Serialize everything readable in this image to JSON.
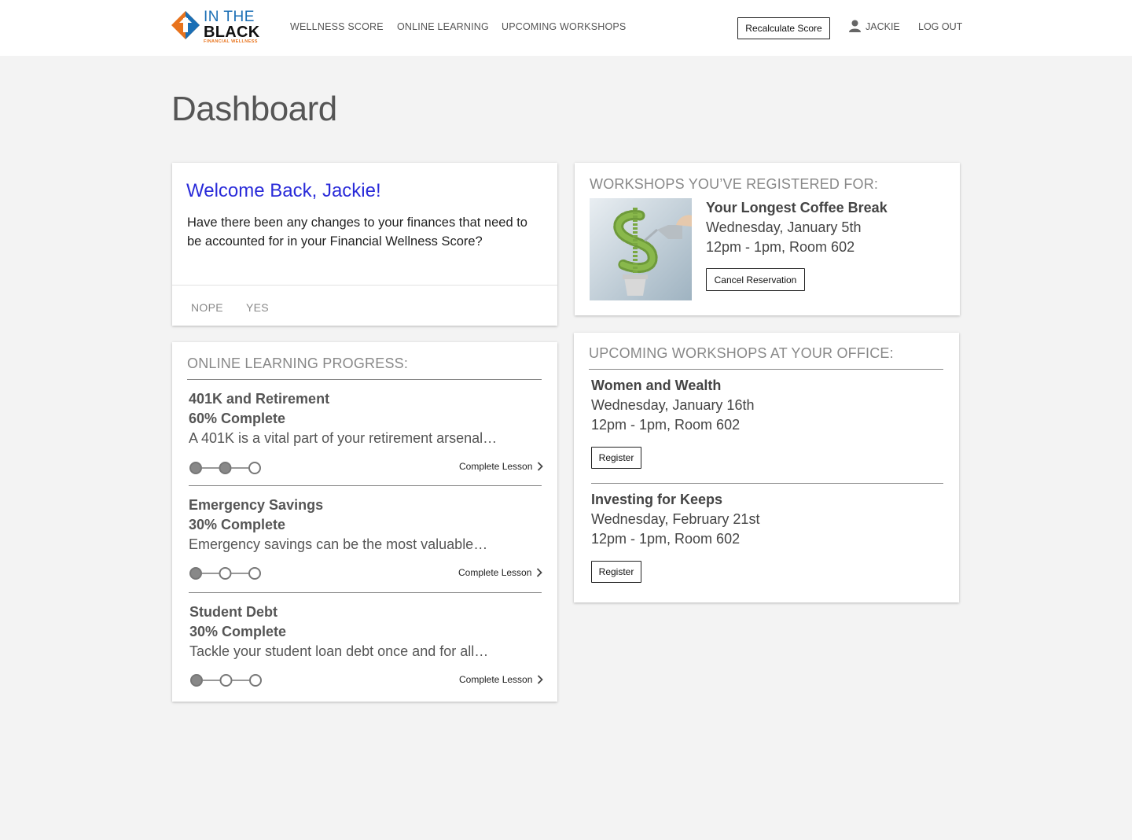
{
  "header": {
    "logo": {
      "line1": "IN THE",
      "line2": "BLACK",
      "line3": "FINANCIAL WELLNESS"
    },
    "nav": [
      "WELLNESS SCORE",
      "ONLINE LEARNING",
      "UPCOMING WORKSHOPS"
    ],
    "recalculate_label": "Recalculate Score",
    "user_name": "JACKIE",
    "logout_label": "LOG OUT",
    "icons": {
      "user": "user-icon",
      "logo": "logo-icon"
    }
  },
  "page": {
    "title": "Dashboard"
  },
  "welcome": {
    "title": "Welcome Back, Jackie!",
    "text": "Have there been any changes to your finances that need to be accounted for in your Financial Wellness Score?",
    "actions": [
      "NOPE",
      "YES"
    ]
  },
  "learning": {
    "heading": "ONLINE LEARNING PROGRESS:",
    "lessons": [
      {
        "title": "401K and Retirement",
        "progress_label": "60% Complete",
        "description": "A 401K is a vital part of your retirement arsenal…",
        "steps_done": 2,
        "steps_total": 3,
        "link": "Complete Lesson"
      },
      {
        "title": "Emergency Savings",
        "progress_label": "30% Complete",
        "description": "Emergency savings can be the most valuable…",
        "steps_done": 1,
        "steps_total": 3,
        "link": "Complete Lesson"
      },
      {
        "title": "Student Debt",
        "progress_label": "30% Complete",
        "description": "Tackle your student loan debt once and for all…",
        "steps_done": 1,
        "steps_total": 3,
        "link": "Complete Lesson"
      }
    ]
  },
  "registered": {
    "heading": "WORKSHOPS YOU’VE REGISTERED FOR:",
    "workshop": {
      "title": "Your Longest Coffee Break",
      "date": "Wednesday, January 5th",
      "time": "12pm - 1pm, Room 602",
      "button": "Cancel Reservation",
      "image": "money-tree-watering-can-image"
    }
  },
  "upcoming": {
    "heading": "UPCOMING WORKSHOPS AT YOUR OFFICE:",
    "workshops": [
      {
        "title": "Women and Wealth",
        "date": "Wednesday, January 16th",
        "time": "12pm - 1pm, Room 602",
        "button": "Register"
      },
      {
        "title": "Investing for Keeps",
        "date": "Wednesday, February 21st",
        "time": "12pm - 1pm, Room 602",
        "button": "Register"
      }
    ]
  },
  "colors": {
    "accent": "#2a2bd9",
    "logo_blue": "#1b6fb5",
    "logo_orange": "#e8731c",
    "background": "#f3f3f3"
  }
}
